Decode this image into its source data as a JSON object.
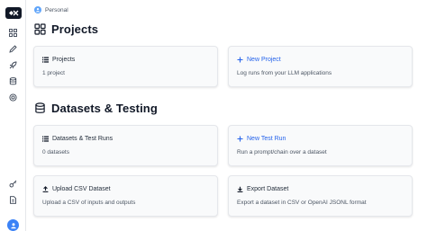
{
  "breadcrumb": {
    "workspace": "Personal"
  },
  "sidebar": {
    "items": [
      {
        "icon": "grid-icon"
      },
      {
        "icon": "pencil-icon"
      },
      {
        "icon": "rocket-icon"
      },
      {
        "icon": "database-icon"
      },
      {
        "icon": "target-icon"
      }
    ],
    "bottom": [
      {
        "icon": "key-icon"
      },
      {
        "icon": "document-icon"
      },
      {
        "icon": "user-avatar-icon"
      }
    ]
  },
  "projects_section": {
    "title": "Projects",
    "cards": [
      {
        "label": "Projects",
        "sub": "1 project",
        "icon": "list-icon"
      },
      {
        "label": "New Project",
        "sub": "Log runs from your LLM applications",
        "icon": "plus-icon"
      }
    ]
  },
  "datasets_section": {
    "title": "Datasets & Testing",
    "cards": [
      {
        "label": "Datasets & Test Runs",
        "sub": "0 datasets",
        "icon": "list-icon"
      },
      {
        "label": "New Test Run",
        "sub": "Run a prompt/chain over a dataset",
        "icon": "plus-icon"
      },
      {
        "label": "Upload CSV Dataset",
        "sub": "Upload a CSV of inputs and outputs",
        "icon": "upload-icon"
      },
      {
        "label": "Export Dataset",
        "sub": "Export a dataset in CSV or OpenAI JSONL format",
        "icon": "download-icon"
      }
    ]
  },
  "colors": {
    "link": "#2563eb",
    "accent": "#3b82f6"
  }
}
